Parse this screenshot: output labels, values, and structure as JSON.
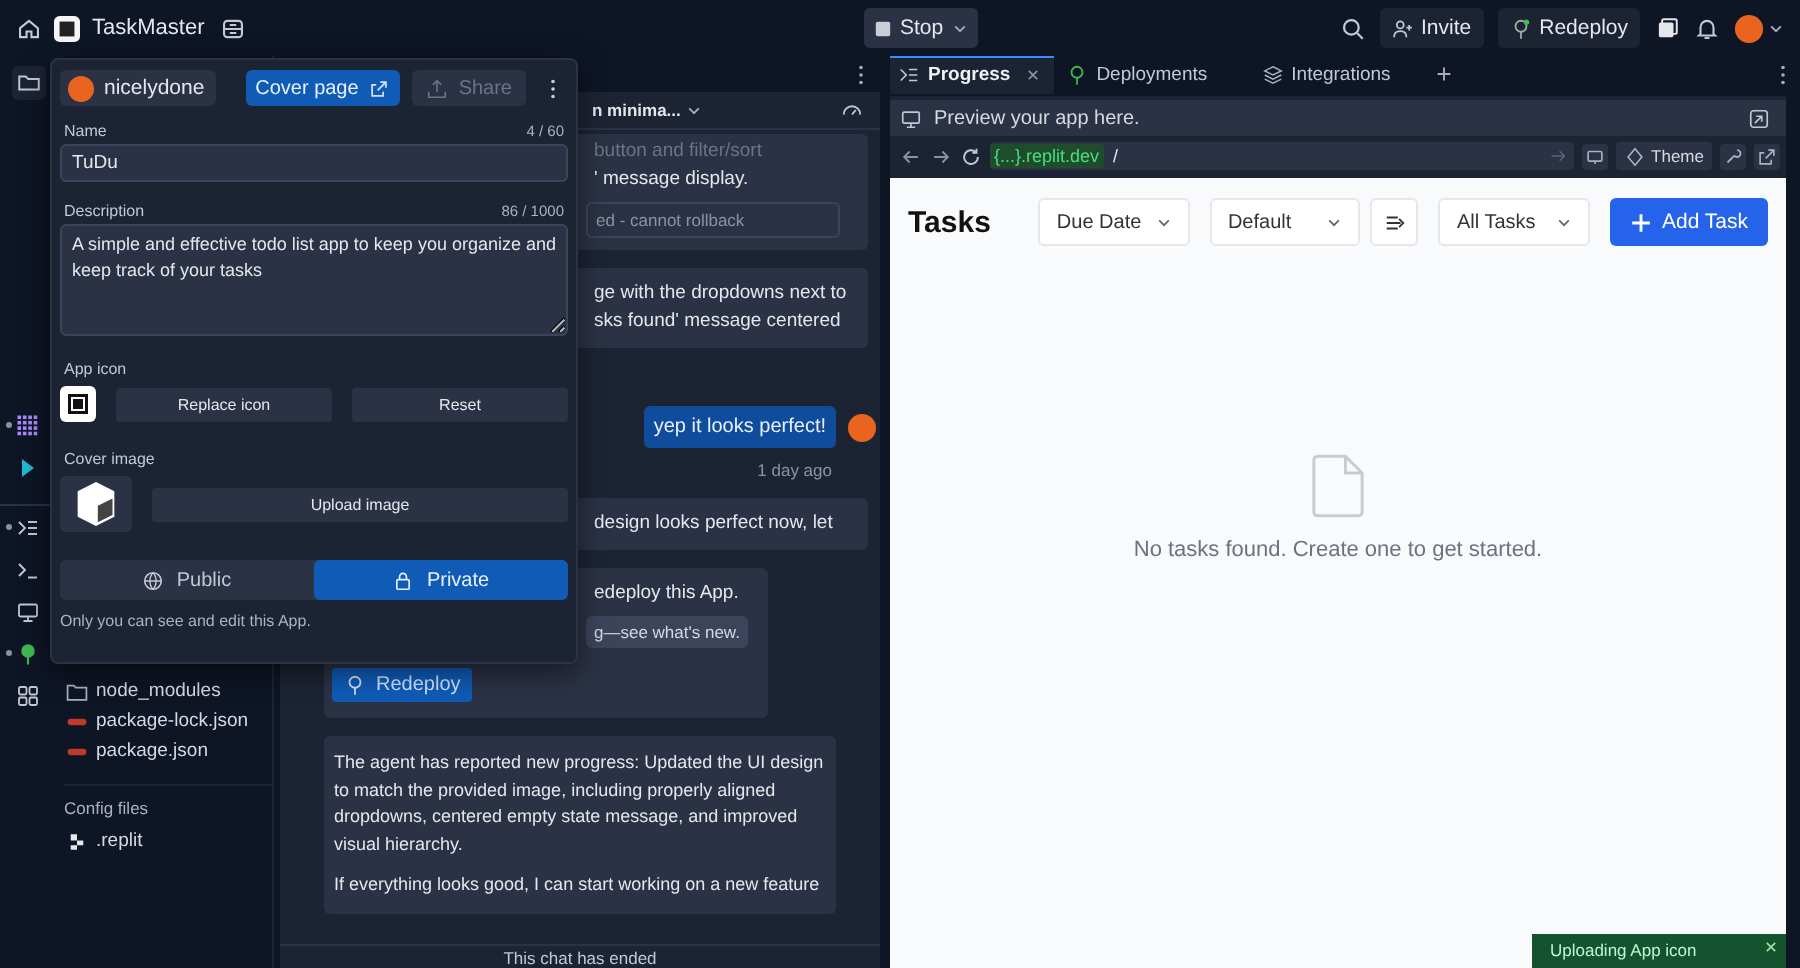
{
  "topbar": {
    "app_name": "TaskMaster",
    "run_button": "Stop",
    "invite_button": "Invite",
    "redeploy_button": "Redeploy"
  },
  "rail": [
    {
      "kind": "files",
      "indicator": false
    },
    {
      "kind": "apps",
      "indicator": true
    },
    {
      "kind": "agent",
      "indicator": false
    },
    {
      "kind": "progress",
      "indicator": true
    },
    {
      "kind": "shell",
      "indicator": false
    },
    {
      "kind": "preview",
      "indicator": false
    },
    {
      "kind": "deploy",
      "indicator": true
    },
    {
      "kind": "grid",
      "indicator": false
    }
  ],
  "file_tree": {
    "items": [
      {
        "kind": "folder",
        "name": "node_modules"
      },
      {
        "kind": "json",
        "name": "package-lock.json"
      },
      {
        "kind": "json",
        "name": "package.json"
      }
    ],
    "sections": [
      {
        "title": "Config files",
        "items": [
          {
            "kind": "config",
            "name": ".replit"
          }
        ]
      }
    ]
  },
  "chat": {
    "header_title": "n minima...",
    "messages": [
      {
        "kind": "agent",
        "lines": [
          "button and filter/sort",
          "' message display."
        ],
        "note": "ed - cannot rollback"
      },
      {
        "kind": "agent",
        "lines": [
          "ge with the dropdowns next to",
          "sks found' message centered"
        ]
      },
      {
        "kind": "user",
        "text": "yep it looks perfect!",
        "time": "1 day ago"
      },
      {
        "kind": "agent",
        "lines": [
          "design looks perfect now, let"
        ]
      },
      {
        "kind": "deploy",
        "lines": [
          "edeploy this App."
        ],
        "note": "g—see what's new.",
        "button": "Redeploy"
      },
      {
        "kind": "report",
        "paragraphs": [
          "The agent has reported new progress: Updated the UI design to match the provided image, including properly aligned dropdowns, centered empty state message, and improved visual hierarchy.",
          "If everything looks good, I can start working on a new feature"
        ]
      }
    ],
    "footer": "This chat has ended"
  },
  "popover": {
    "owner": "nicelydone",
    "cover_button": "Cover page",
    "share_button": {
      "label": "Share",
      "disabled": true
    },
    "name": {
      "label": "Name",
      "count": "4 / 60",
      "value": "TuDu"
    },
    "description": {
      "label": "Description",
      "count": "86 / 1000",
      "value": "A simple and effective todo list app to keep you organize and keep track of your tasks"
    },
    "app_icon": {
      "label": "App icon",
      "buttons": [
        "Replace icon",
        "Reset"
      ]
    },
    "cover_image": {
      "label": "Cover image",
      "button": "Upload image"
    },
    "visibility": [
      {
        "label": "Public",
        "selected": false
      },
      {
        "label": "Private",
        "selected": true
      }
    ],
    "note": "Only you can see and edit this App."
  },
  "preview": {
    "tabs": [
      {
        "label": "Progress",
        "selected": true,
        "closable": true
      },
      {
        "label": "Deployments",
        "selected": false,
        "closable": false
      },
      {
        "label": "Integrations",
        "selected": false,
        "closable": false
      }
    ],
    "banner": "Preview your app here.",
    "url": {
      "host": "{...}.replit.dev",
      "path": "/"
    },
    "theme_button": "Theme",
    "app": {
      "title": "Tasks",
      "selects": [
        "Due Date",
        "Default"
      ],
      "status_select": "All Tasks",
      "add_button": "Add Task",
      "empty_message": "No tasks found. Create one to get started."
    },
    "toast": "Uploading App icon"
  }
}
